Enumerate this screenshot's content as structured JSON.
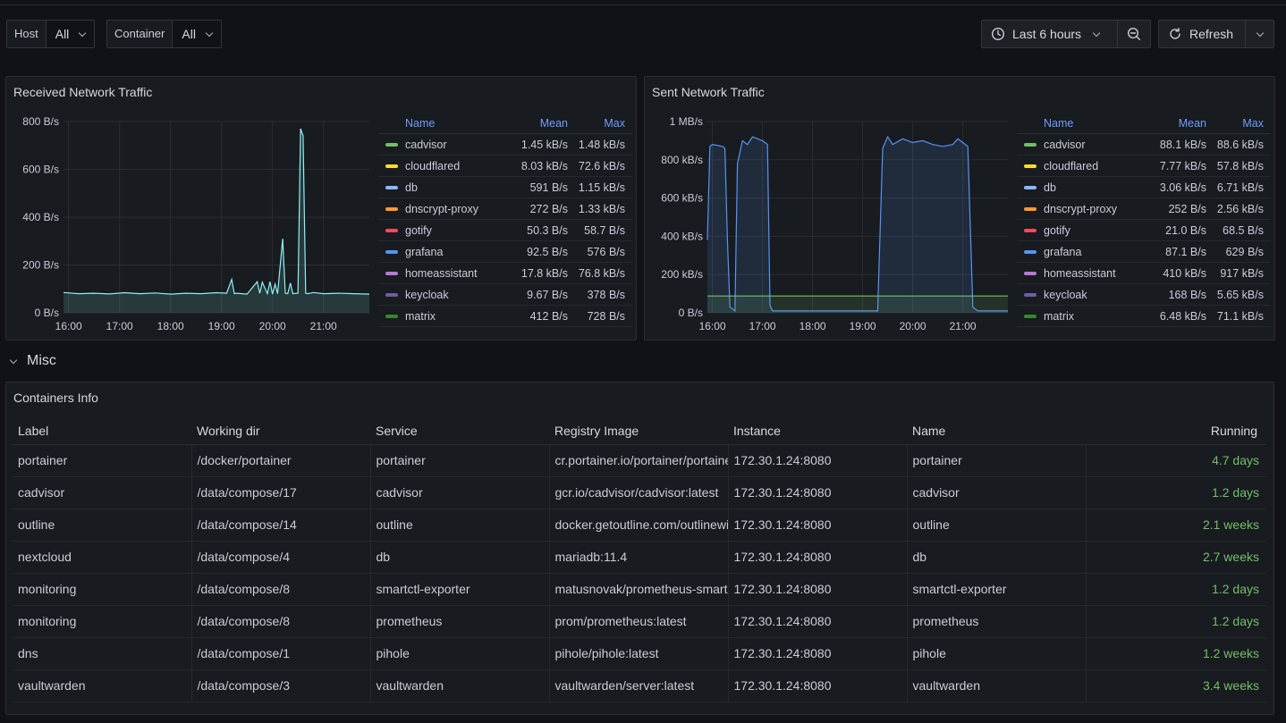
{
  "variables": [
    {
      "label": "Host",
      "value": "All"
    },
    {
      "label": "Container",
      "value": "All"
    }
  ],
  "toolbar": {
    "time_range": "Last 6 hours",
    "refresh_label": "Refresh"
  },
  "colors": {
    "cadvisor": "#73bf69",
    "cloudflared": "#fade2a",
    "db": "#8ab8ff",
    "dnscrypt-proxy": "#ff9830",
    "gotify": "#f2495c",
    "grafana": "#5794f2",
    "homeassistant": "#b877d9",
    "keycloak": "#705da0",
    "matrix": "#37872d",
    "running": "#73bf69"
  },
  "received": {
    "title": "Received Network Traffic",
    "legend_headers": {
      "name": "Name",
      "mean": "Mean",
      "max": "Max"
    },
    "legend": [
      {
        "name": "cadvisor",
        "mean": "1.45 kB/s",
        "max": "1.48 kB/s"
      },
      {
        "name": "cloudflared",
        "mean": "8.03 kB/s",
        "max": "72.6 kB/s"
      },
      {
        "name": "db",
        "mean": "591 B/s",
        "max": "1.15 kB/s"
      },
      {
        "name": "dnscrypt-proxy",
        "mean": "272 B/s",
        "max": "1.33 kB/s"
      },
      {
        "name": "gotify",
        "mean": "50.3 B/s",
        "max": "58.7 B/s"
      },
      {
        "name": "grafana",
        "mean": "92.5 B/s",
        "max": "576 B/s"
      },
      {
        "name": "homeassistant",
        "mean": "17.8 kB/s",
        "max": "76.8 kB/s"
      },
      {
        "name": "keycloak",
        "mean": "9.67 B/s",
        "max": "378 B/s"
      },
      {
        "name": "matrix",
        "mean": "412 B/s",
        "max": "728 B/s"
      }
    ]
  },
  "sent": {
    "title": "Sent Network Traffic",
    "legend_headers": {
      "name": "Name",
      "mean": "Mean",
      "max": "Max"
    },
    "legend": [
      {
        "name": "cadvisor",
        "mean": "88.1 kB/s",
        "max": "88.6 kB/s"
      },
      {
        "name": "cloudflared",
        "mean": "7.77 kB/s",
        "max": "57.8 kB/s"
      },
      {
        "name": "db",
        "mean": "3.06 kB/s",
        "max": "6.71 kB/s"
      },
      {
        "name": "dnscrypt-proxy",
        "mean": "252 B/s",
        "max": "2.56 kB/s"
      },
      {
        "name": "gotify",
        "mean": "21.0 B/s",
        "max": "68.5 B/s"
      },
      {
        "name": "grafana",
        "mean": "87.1 B/s",
        "max": "629 B/s"
      },
      {
        "name": "homeassistant",
        "mean": "410 kB/s",
        "max": "917 kB/s"
      },
      {
        "name": "keycloak",
        "mean": "168 B/s",
        "max": "5.65 kB/s"
      },
      {
        "name": "matrix",
        "mean": "6.48 kB/s",
        "max": "71.1 kB/s"
      }
    ]
  },
  "chart_data": [
    {
      "type": "line",
      "title": "Received Network Traffic",
      "x_ticks": [
        "16:00",
        "17:00",
        "18:00",
        "19:00",
        "20:00",
        "21:00"
      ],
      "y_ticks": [
        "0 B/s",
        "200 B/s",
        "400 B/s",
        "600 B/s",
        "800 B/s"
      ],
      "ylim": [
        0,
        800
      ],
      "xlim": [
        15.9,
        21.9
      ],
      "series": [
        {
          "name": "homeassistant",
          "color": "#8ff0f0",
          "x": [
            15.9,
            16.2,
            16.5,
            16.8,
            17.1,
            17.4,
            17.7,
            18.0,
            18.3,
            18.6,
            18.9,
            19.1,
            19.2,
            19.25,
            19.3,
            19.5,
            19.7,
            19.75,
            19.8,
            19.9,
            19.95,
            20.0,
            20.05,
            20.1,
            20.2,
            20.25,
            20.3,
            20.35,
            20.4,
            20.5,
            20.55,
            20.6,
            20.65,
            20.7,
            20.8,
            21.0,
            21.3,
            21.6,
            21.9
          ],
          "y": [
            85,
            80,
            82,
            79,
            84,
            80,
            83,
            78,
            82,
            80,
            84,
            82,
            140,
            80,
            82,
            78,
            130,
            82,
            128,
            80,
            130,
            78,
            120,
            80,
            310,
            82,
            80,
            125,
            80,
            82,
            770,
            740,
            82,
            80,
            85,
            80,
            82,
            80,
            78
          ]
        }
      ]
    },
    {
      "type": "area",
      "title": "Sent Network Traffic",
      "x_ticks": [
        "16:00",
        "17:00",
        "18:00",
        "19:00",
        "20:00",
        "21:00"
      ],
      "y_ticks": [
        "0 B/s",
        "200 kB/s",
        "400 kB/s",
        "600 kB/s",
        "800 kB/s",
        "1 MB/s"
      ],
      "ylim": [
        0,
        1000
      ],
      "xlim": [
        15.9,
        21.9
      ],
      "series": [
        {
          "name": "homeassistant",
          "color": "#5794f2",
          "x": [
            15.9,
            15.95,
            16.0,
            16.2,
            16.25,
            16.3,
            16.35,
            16.4,
            16.45,
            16.5,
            16.6,
            16.7,
            16.8,
            17.0,
            17.1,
            17.15,
            17.2,
            17.5,
            18.0,
            18.5,
            19.0,
            19.2,
            19.3,
            19.4,
            19.5,
            19.6,
            19.8,
            20.0,
            20.2,
            20.4,
            20.6,
            20.8,
            20.9,
            21.0,
            21.1,
            21.2,
            21.3,
            21.6,
            21.9
          ],
          "y": [
            380,
            870,
            880,
            870,
            860,
            380,
            30,
            20,
            10,
            780,
            900,
            880,
            920,
            900,
            880,
            40,
            10,
            10,
            10,
            10,
            10,
            10,
            10,
            860,
            920,
            880,
            910,
            890,
            900,
            880,
            870,
            880,
            910,
            890,
            870,
            30,
            10,
            10,
            10
          ]
        },
        {
          "name": "cadvisor",
          "color": "#73bf69",
          "x": [
            15.9,
            21.9
          ],
          "y": [
            88,
            88
          ]
        }
      ]
    }
  ],
  "misc": {
    "title": "Misc"
  },
  "containers": {
    "title": "Containers Info",
    "headers": [
      "Label",
      "Working dir",
      "Service",
      "Registry Image",
      "Instance",
      "Name",
      "Running"
    ],
    "rows": [
      [
        "portainer",
        "/docker/portainer",
        "portainer",
        "cr.portainer.io/portainer/portainer-ce:latest",
        "172.30.1.24:8080",
        "portainer",
        "4.7 days"
      ],
      [
        "cadvisor",
        "/data/compose/17",
        "cadvisor",
        "gcr.io/cadvisor/cadvisor:latest",
        "172.30.1.24:8080",
        "cadvisor",
        "1.2 days"
      ],
      [
        "outline",
        "/data/compose/14",
        "outline",
        "docker.getoutline.com/outlinewiki/outline:latest",
        "172.30.1.24:8080",
        "outline",
        "2.1 weeks"
      ],
      [
        "nextcloud",
        "/data/compose/4",
        "db",
        "mariadb:11.4",
        "172.30.1.24:8080",
        "db",
        "2.7 weeks"
      ],
      [
        "monitoring",
        "/data/compose/8",
        "smartctl-exporter",
        "matusnovak/prometheus-smartctl:latest",
        "172.30.1.24:8080",
        "smartctl-exporter",
        "1.2 days"
      ],
      [
        "monitoring",
        "/data/compose/8",
        "prometheus",
        "prom/prometheus:latest",
        "172.30.1.24:8080",
        "prometheus",
        "1.2 days"
      ],
      [
        "dns",
        "/data/compose/1",
        "pihole",
        "pihole/pihole:latest",
        "172.30.1.24:8080",
        "pihole",
        "1.2 weeks"
      ],
      [
        "vaultwarden",
        "/data/compose/3",
        "vaultwarden",
        "vaultwarden/server:latest",
        "172.30.1.24:8080",
        "vaultwarden",
        "3.4 weeks"
      ]
    ]
  }
}
